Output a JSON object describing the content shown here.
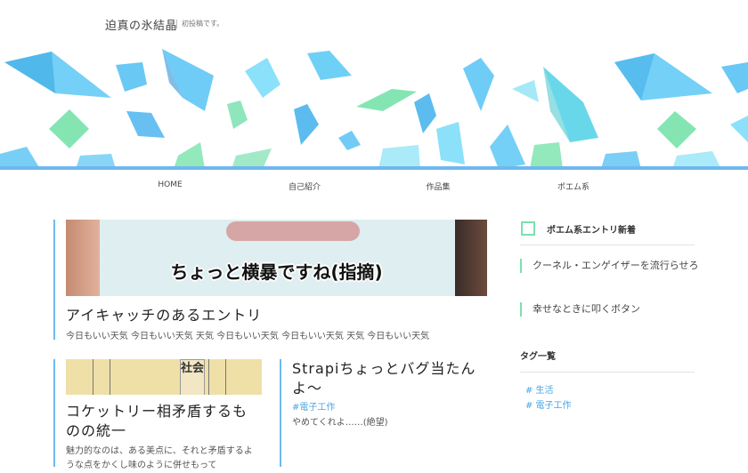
{
  "site": {
    "title": "迫真の氷結晶",
    "tagline": "初投稿です。"
  },
  "nav": {
    "items": [
      "HOME",
      "自己紹介",
      "作品集",
      "ポエム系"
    ]
  },
  "featured": {
    "thumbnail_caption": "ちょっと横暴ですね(指摘)",
    "title": "アイキャッチのあるエントリ",
    "excerpt": "今日もいい天気 今日もいい天気 天気 今日もいい天気 今日もいい天気 天気 今日もいい天気"
  },
  "entries": [
    {
      "thumbnail_sign": "社会",
      "title": "コケットリー相矛盾するものの統一",
      "excerpt": "魅力的なのは、ある美点に、それと矛盾するような点をかくし味のように併せもって"
    },
    {
      "title": "Strapiちょっとバグ当たんよ〜",
      "tag": "#電子工作",
      "excerpt": "やめてくれよ……(絶望)"
    }
  ],
  "sidebar": {
    "poem_widget_title": "ポエム系エントリ新着",
    "poem_links": [
      "クーネル・エンゲイザーを流行らせろ",
      "幸せなときに叩くボタン"
    ],
    "tag_widget_title": "タグ一覧",
    "tags": [
      "# 生活",
      "# 電子工作"
    ]
  },
  "colors": {
    "accent_blue": "#6fb8ee",
    "accent_green": "#7be0b0",
    "link": "#4aa6e6"
  }
}
